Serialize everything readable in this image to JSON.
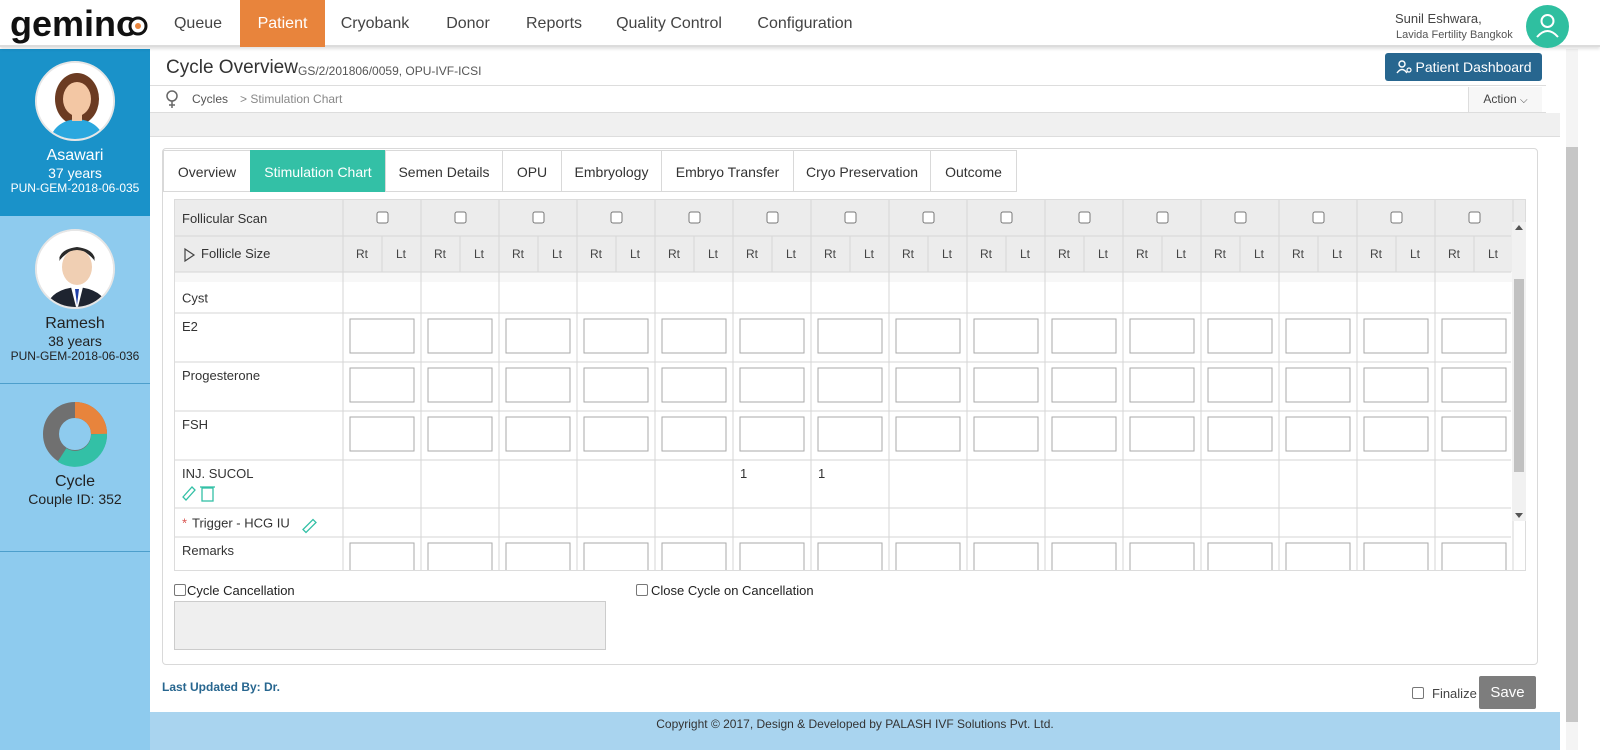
{
  "brand": {
    "logo_text": "gemino"
  },
  "nav": {
    "items": [
      {
        "label": "Queue",
        "active": false
      },
      {
        "label": "Patient",
        "active": true
      },
      {
        "label": "Cryobank",
        "active": false
      },
      {
        "label": "Donor",
        "active": false
      },
      {
        "label": "Reports",
        "active": false
      },
      {
        "label": "Quality Control",
        "active": false
      },
      {
        "label": "Configuration",
        "active": false
      }
    ],
    "accent_color": "#e8843c"
  },
  "user": {
    "name": "Sunil Eshwara,",
    "org": "Lavida Fertility Bangkok",
    "avatar_icon": "user-icon"
  },
  "sidebar": {
    "patients": [
      {
        "name": "Asawari",
        "age": "37 years",
        "id": "PUN-GEM-2018-06-035",
        "selected": true
      },
      {
        "name": "Ramesh",
        "age": "38 years",
        "id": "PUN-GEM-2018-06-036",
        "selected": false
      }
    ],
    "cycle": {
      "title": "Cycle",
      "couple": "Couple ID: 352"
    }
  },
  "header": {
    "title": "Cycle Overview",
    "subtitle": "GS/2/201806/0059, OPU-IVF-ICSI",
    "dashboard_btn": "Patient Dashboard",
    "breadcrumb": [
      "Cycles",
      "> Stimulation Chart"
    ],
    "action_label": "Action"
  },
  "tabs": [
    {
      "label": "Overview",
      "active": false
    },
    {
      "label": "Stimulation Chart",
      "active": true
    },
    {
      "label": "Semen Details",
      "active": false
    },
    {
      "label": "OPU",
      "active": false
    },
    {
      "label": "Embryology",
      "active": false
    },
    {
      "label": "Embryo Transfer",
      "active": false
    },
    {
      "label": "Cryo Preservation",
      "active": false
    },
    {
      "label": "Outcome",
      "active": false
    }
  ],
  "grid": {
    "column_count": 15,
    "sub_headers": [
      "Rt",
      "Lt"
    ],
    "rows": [
      {
        "label": "Follicular Scan",
        "type": "checkbox"
      },
      {
        "label": "Follicle Size",
        "type": "subheader"
      },
      {
        "label": "Cyst",
        "type": "empty"
      },
      {
        "label": "E2",
        "type": "input"
      },
      {
        "label": "Progesterone",
        "type": "input"
      },
      {
        "label": "FSH",
        "type": "input"
      },
      {
        "label": "INJ. SUCOL",
        "type": "values",
        "values": [
          "",
          "",
          "",
          "",
          "",
          "1",
          "1",
          "",
          "",
          "",
          "",
          "",
          "",
          "",
          ""
        ]
      },
      {
        "label": "Trigger - HCG IU",
        "type": "trigger",
        "required_mark": "*"
      },
      {
        "label": "Remarks",
        "type": "input"
      }
    ]
  },
  "form": {
    "cycle_cancellation": "Cycle Cancellation",
    "close_cycle": "Close Cycle on Cancellation",
    "last_updated": "Last Updated By: Dr.",
    "finalize": "Finalize",
    "save": "Save"
  },
  "footer": {
    "text": "Copyright © 2017, Design & Developed by PALASH IVF Solutions Pvt. Ltd."
  },
  "colors": {
    "teal": "#33c0a6",
    "blue": "#27668f",
    "sidebar_selected": "#1a92c9",
    "sidebar_bg": "#8ecbee"
  }
}
